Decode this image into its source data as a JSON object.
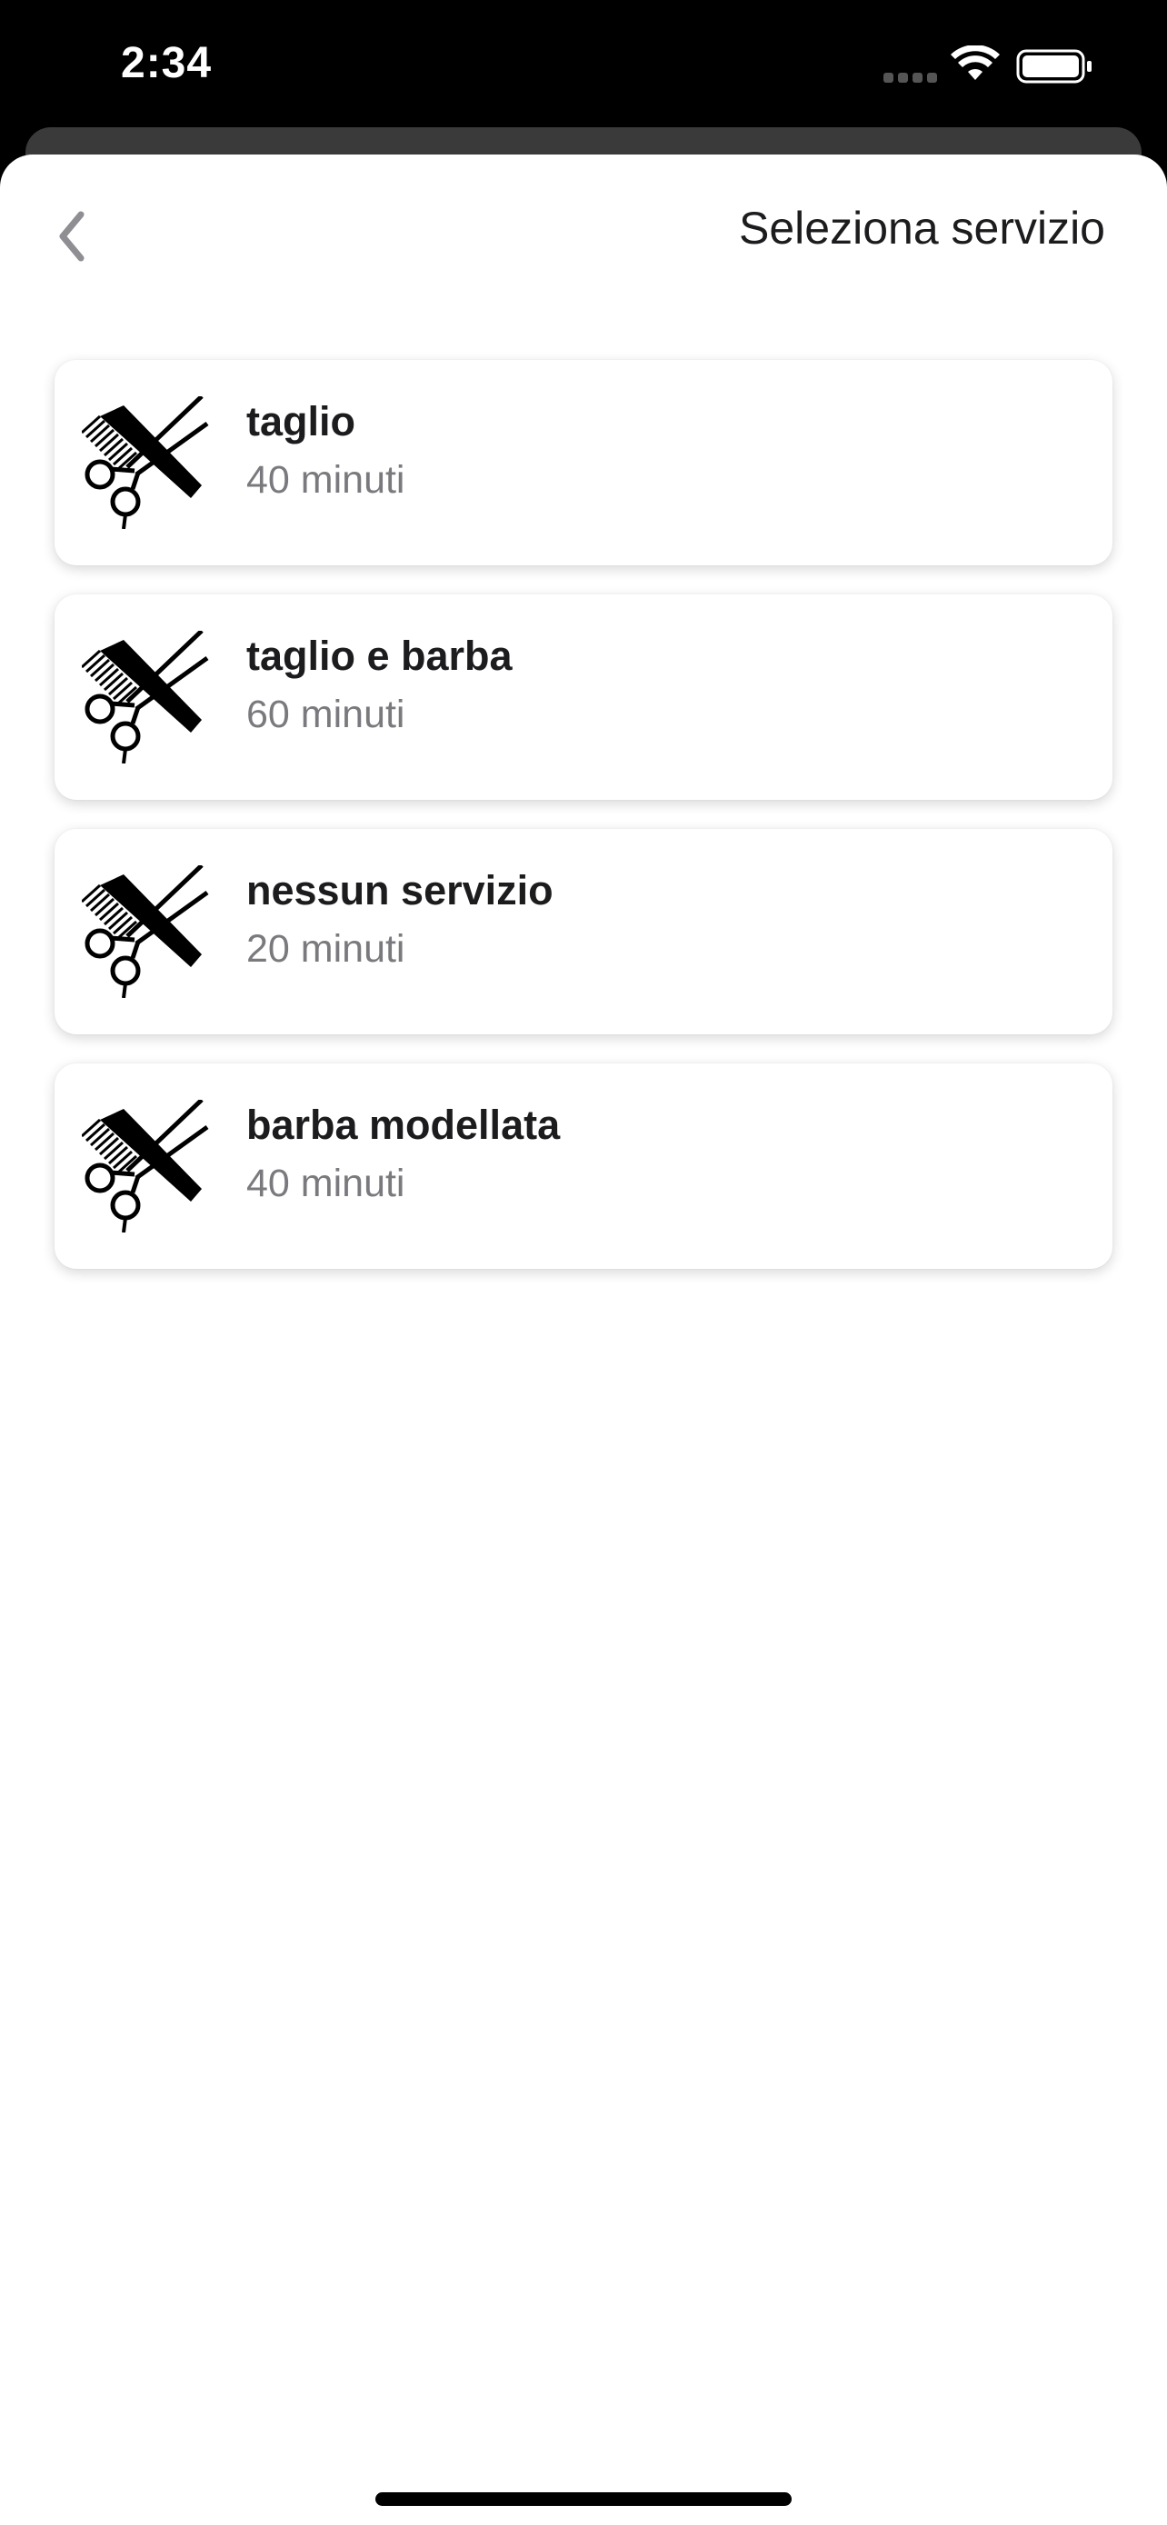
{
  "status_bar": {
    "time": "2:34",
    "icons": [
      "signal-icon",
      "wifi-icon",
      "battery-icon"
    ]
  },
  "nav": {
    "back_icon": "chevron-left-icon",
    "title": "Seleziona servizio"
  },
  "services": [
    {
      "name": "taglio",
      "duration": "40 minuti",
      "icon": "comb-scissors-icon"
    },
    {
      "name": "taglio e barba",
      "duration": "60 minuti",
      "icon": "comb-scissors-icon"
    },
    {
      "name": "nessun servizio",
      "duration": "20 minuti",
      "icon": "comb-scissors-icon"
    },
    {
      "name": "barba modellata",
      "duration": "40 minuti",
      "icon": "comb-scissors-icon"
    }
  ],
  "colors": {
    "title_text": "#1c1c1e",
    "secondary_text": "#7a7a7e",
    "chevron": "#8e8e93"
  }
}
